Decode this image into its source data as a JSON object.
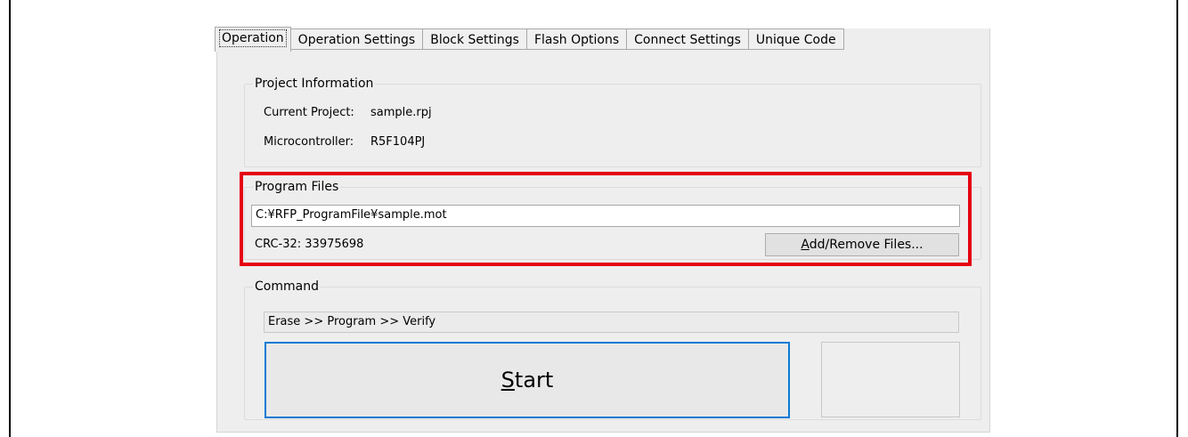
{
  "tabs": [
    {
      "label": "Operation",
      "active": true
    },
    {
      "label": "Operation Settings",
      "active": false
    },
    {
      "label": "Block Settings",
      "active": false
    },
    {
      "label": "Flash Options",
      "active": false
    },
    {
      "label": "Connect Settings",
      "active": false
    },
    {
      "label": "Unique Code",
      "active": false
    }
  ],
  "project_info": {
    "legend": "Project Information",
    "current_project_label": "Current Project:",
    "current_project_value": "sample.rpj",
    "microcontroller_label": "Microcontroller:",
    "microcontroller_value": "R5F104PJ"
  },
  "program_files": {
    "legend": "Program Files",
    "file_path": "C:¥RFP_ProgramFile¥sample.mot",
    "crc": "CRC-32: 33975698",
    "add_remove_accel": "A",
    "add_remove_rest": "dd/Remove Files..."
  },
  "command": {
    "legend": "Command",
    "sequence": "Erase >> Program >> Verify",
    "start_accel": "S",
    "start_rest": "tart"
  },
  "colors": {
    "highlight": "#e60012",
    "start_border": "#0a7bd6"
  }
}
